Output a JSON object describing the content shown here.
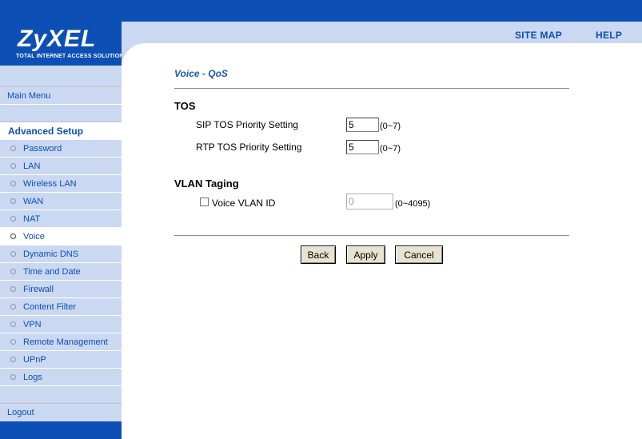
{
  "header": {
    "logo_text": "ZyXEL",
    "logo_tagline": "TOTAL INTERNET ACCESS SOLUTION",
    "site_map_label": "SITE MAP",
    "help_label": "HELP"
  },
  "sidebar": {
    "main_menu": "Main Menu",
    "advanced_setup": "Advanced Setup",
    "items": [
      {
        "label": "Password"
      },
      {
        "label": "LAN"
      },
      {
        "label": "Wireless LAN"
      },
      {
        "label": "WAN"
      },
      {
        "label": "NAT"
      },
      {
        "label": "Voice",
        "active": true
      },
      {
        "label": "Dynamic DNS"
      },
      {
        "label": "Time and Date"
      },
      {
        "label": "Firewall"
      },
      {
        "label": "Content Filter"
      },
      {
        "label": "VPN"
      },
      {
        "label": "Remote Management"
      },
      {
        "label": "UPnP"
      },
      {
        "label": "Logs"
      }
    ],
    "logout": "Logout"
  },
  "main": {
    "title": "Voice - QoS",
    "tos": {
      "heading": "TOS",
      "sip_label": "SIP TOS Priority Setting",
      "sip_value": "5",
      "sip_range": "(0~7)",
      "rtp_label": "RTP TOS Priority Setting",
      "rtp_value": "5",
      "rtp_range": "(0~7)"
    },
    "vlan": {
      "heading": "VLAN Taging",
      "checkbox_label": "Voice VLAN ID",
      "checked": false,
      "value": "0",
      "range": "(0~4095)"
    },
    "buttons": {
      "back": "Back",
      "apply": "Apply",
      "cancel": "Cancel"
    }
  },
  "colors": {
    "brand_blue": "#0c4fb5",
    "sidebar_bg": "#cad8f1"
  }
}
